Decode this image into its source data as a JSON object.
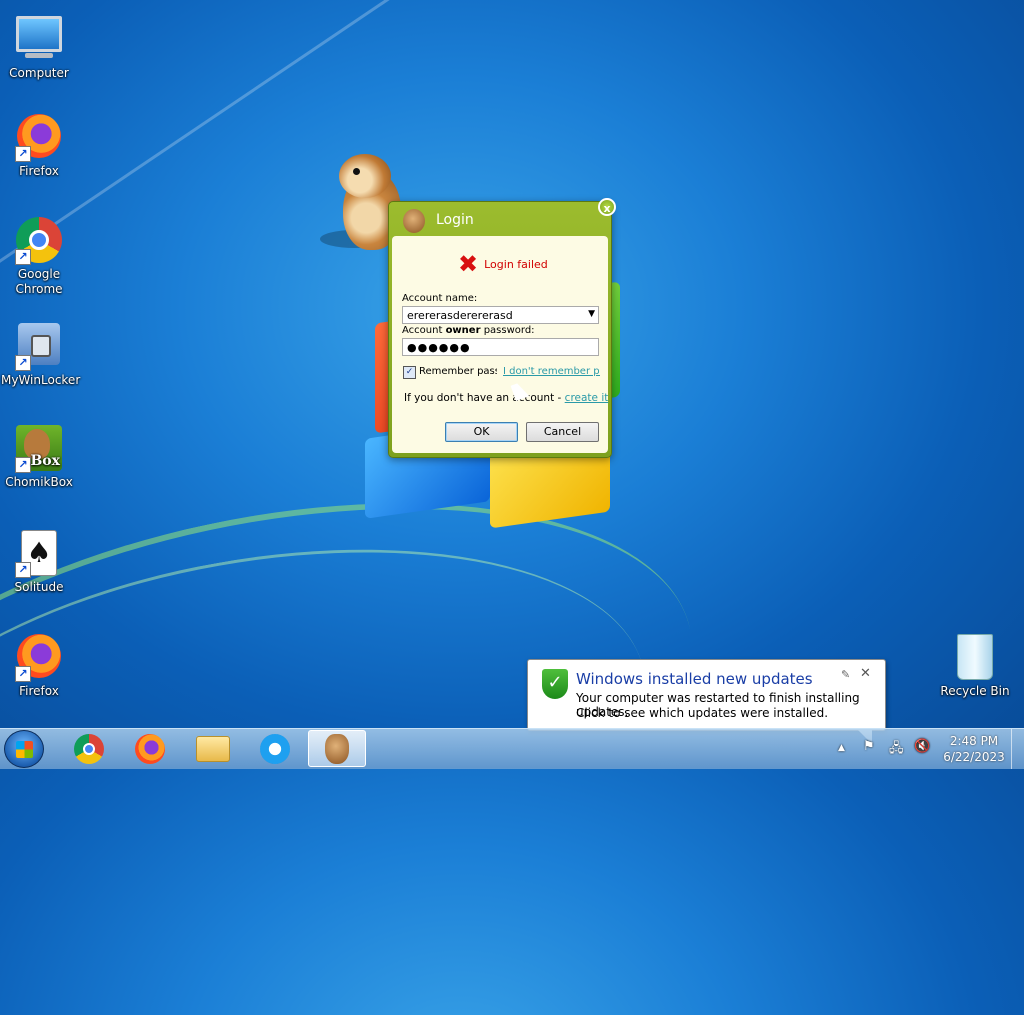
{
  "desktop": {
    "icons": [
      {
        "label": "Computer",
        "icon": "computer-icon",
        "shortcut": false
      },
      {
        "label": "Firefox",
        "icon": "firefox-icon",
        "shortcut": true
      },
      {
        "label": "Google Chrome",
        "icon": "chrome-icon",
        "shortcut": true
      },
      {
        "label": "MyWinLocker",
        "icon": "mywinlocker-icon",
        "shortcut": true
      },
      {
        "label": "ChomikBox",
        "icon": "chomikbox-icon",
        "shortcut": true,
        "badge": "Box"
      },
      {
        "label": "Solitude",
        "icon": "solitude-card-icon",
        "shortcut": true,
        "card_glyph": "♠"
      },
      {
        "label": "Firefox",
        "icon": "firefox-icon",
        "shortcut": true
      },
      {
        "label": "Recycle Bin",
        "icon": "recycle-bin-icon",
        "shortcut": false
      }
    ],
    "shortcut_arrow": "↗"
  },
  "login": {
    "title": "Login",
    "close_glyph": "x",
    "error_glyph": "✖",
    "error_text": "Login failed",
    "account_label": "Account name:",
    "account_value": "erererasderererasd",
    "dropdown_glyph": "▼",
    "password_label_pre": "Account ",
    "password_label_bold": "owner",
    "password_label_post": " password:",
    "password_mask": "●●●●●●",
    "remember_checked": true,
    "check_glyph": "✓",
    "remember_label": "Remember passw",
    "forgot_link": "I don't remember pas",
    "no_account_text": "If you don't have an account - ",
    "create_link": "create it",
    "ok_label": "OK",
    "cancel_label": "Cancel"
  },
  "notification": {
    "title": "Windows installed new updates",
    "line1": "Your computer was restarted to finish installing updates.",
    "line2": "Click to see which updates were installed.",
    "shield_glyph": "✓",
    "pin_glyph": "✎",
    "close_glyph": "✕"
  },
  "taskbar": {
    "pinned": [
      {
        "name": "chrome",
        "active": false
      },
      {
        "name": "firefox",
        "active": false
      },
      {
        "name": "file-explorer",
        "active": false
      },
      {
        "name": "internet-explorer",
        "active": false
      },
      {
        "name": "chomikbox",
        "active": true
      }
    ],
    "tray": {
      "show_hidden_glyph": "▲",
      "network_glyph": "🖧",
      "volume_glyph": "🔇"
    },
    "clock": {
      "time": "2:48 PM",
      "date": "6/22/2023"
    }
  },
  "colors": {
    "login_frame": "#9cbc2e",
    "error_red": "#d10000",
    "link_teal": "#2a9aa8",
    "notification_title": "#1a3ea6"
  }
}
